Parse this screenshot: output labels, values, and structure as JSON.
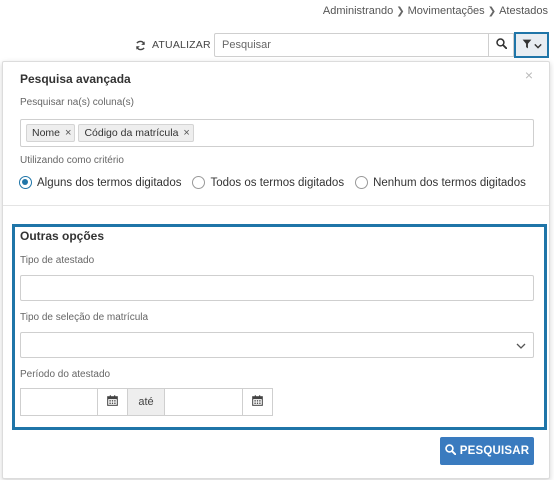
{
  "breadcrumb": {
    "items": [
      "Administrando",
      "Movimentações",
      "Atestados"
    ]
  },
  "toolbar": {
    "refresh_label": "ATUALIZAR",
    "search_placeholder": "Pesquisar",
    "search_value": ""
  },
  "advanced_search": {
    "title": "Pesquisa avançada",
    "close_symbol": "×",
    "columns_label": "Pesquisar na(s) coluna(s)",
    "column_tags": [
      "Nome",
      "Código da matrícula"
    ],
    "criteria_label": "Utilizando como critério",
    "criteria_options": [
      {
        "label": "Alguns dos termos digitados",
        "checked": true
      },
      {
        "label": "Todos os termos digitados",
        "checked": false
      },
      {
        "label": "Nenhum dos termos digitados",
        "checked": false
      }
    ]
  },
  "other_options": {
    "title": "Outras opções",
    "tipo_atestado_label": "Tipo de atestado",
    "tipo_atestado_value": "",
    "tipo_selecao_label": "Tipo de seleção de matrícula",
    "tipo_selecao_value": "",
    "periodo_label": "Período do atestado",
    "periodo_start": "",
    "periodo_separator": "até",
    "periodo_end": ""
  },
  "submit_label": "PESQUISAR",
  "colors": {
    "accent": "#1f75a8",
    "primary_button": "#3a7bbf"
  },
  "icons": [
    "chevron-right-icon",
    "refresh-icon",
    "search-icon",
    "filter-icon",
    "chevron-down-icon",
    "calendar-icon",
    "close-icon"
  ]
}
